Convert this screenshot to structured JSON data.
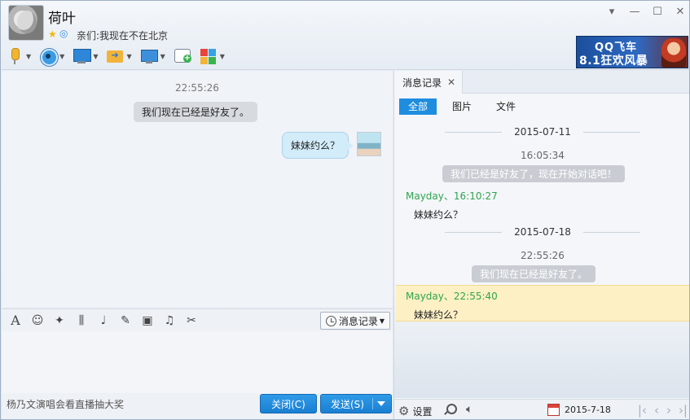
{
  "contact": {
    "name": "荷叶",
    "signature": "亲们:我现在不在北京"
  },
  "banner": {
    "line1": "QQ飞车",
    "line2": "8.1狂欢风暴"
  },
  "chat": {
    "time": "22:55:26",
    "system_message": "我们现在已经是好友了。",
    "my_message": "妹妹约么？"
  },
  "input_toolbar": {
    "history_label": "消息记录"
  },
  "bottom": {
    "ad_text": "杨乃文演唱会看直播抽大奖",
    "close_label": "关闭(C)",
    "send_label": "发送(S)"
  },
  "history_panel": {
    "tab_label": "消息记录",
    "filters": [
      "全部",
      "图片",
      "文件"
    ],
    "entries": {
      "date1": "2015-07-11",
      "time1": "16:05:34",
      "sys1": "我们已经是好友了，现在开始对话吧！",
      "sender1": "Mayday、16:10:27",
      "text1": "妹妹约么？",
      "date2": "2015-07-18",
      "time2": "22:55:26",
      "sys2": "我们现在已经是好友了。",
      "sender2": "Mayday、22:55:40",
      "text2": "妹妹约么？"
    },
    "bottom": {
      "settings_label": "设置",
      "date": "2015-7-18"
    }
  },
  "colors": {
    "accent": "#1f8ddf",
    "sender": "#2fa44f",
    "highlight": "#fdf0c4"
  }
}
